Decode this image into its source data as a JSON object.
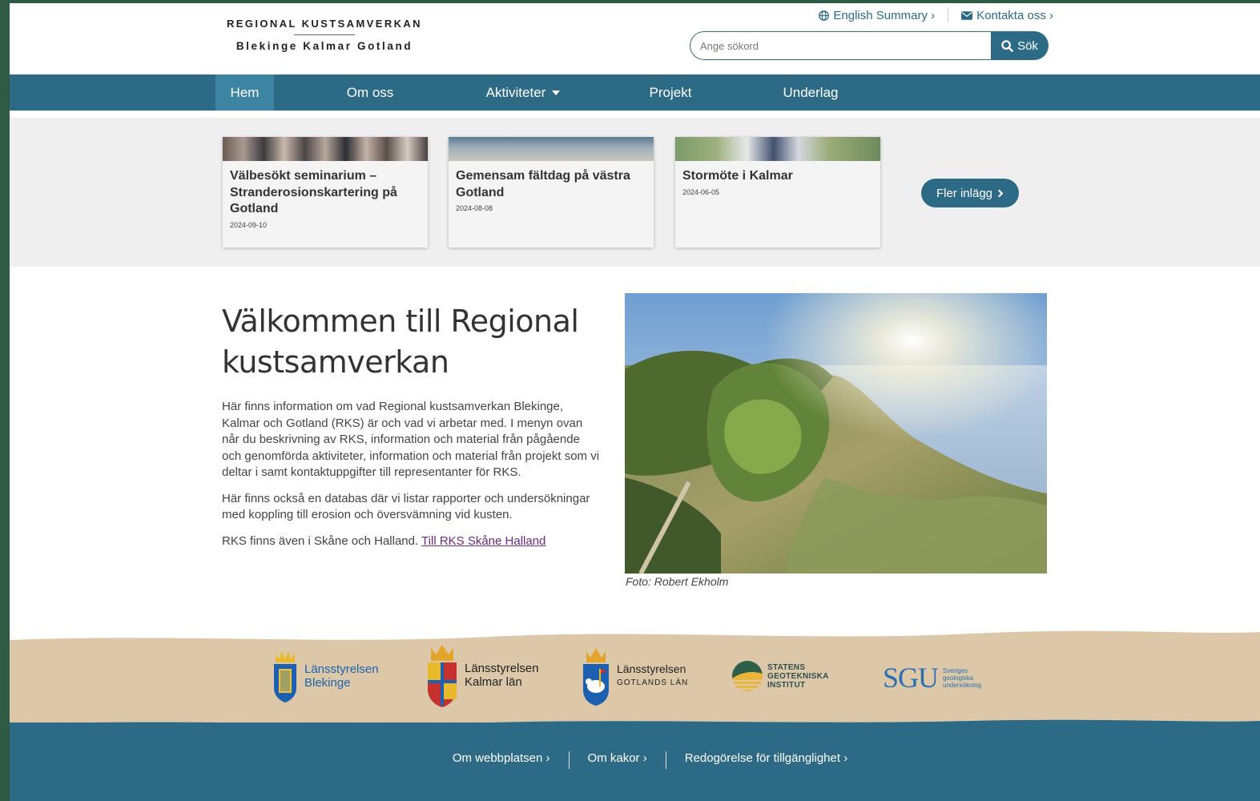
{
  "logo": {
    "top": "REGIONAL KUSTSAMVERKAN",
    "bottom": "Blekinge Kalmar Gotland"
  },
  "utility": {
    "english": "English Summary ›",
    "contact": "Kontakta oss ›"
  },
  "search": {
    "placeholder": "Ange sökord",
    "button": "Sök"
  },
  "nav": [
    {
      "label": "Hem"
    },
    {
      "label": "Om oss"
    },
    {
      "label": "Aktiviteter"
    },
    {
      "label": "Projekt"
    },
    {
      "label": "Underlag"
    }
  ],
  "news": {
    "cards": [
      {
        "title": "Välbesökt seminarium – Stranderosionskartering på Gotland",
        "date": "2024-09-10"
      },
      {
        "title": "Gemensam fältdag på västra Gotland",
        "date": "2024-08-08"
      },
      {
        "title": "Stormöte i Kalmar",
        "date": "2024-06-05"
      }
    ],
    "more": "Fler inlägg"
  },
  "intro": {
    "heading": "Välkommen till  Regional kustsamverkan",
    "p1": "Här finns information om vad Regional kustsamverkan Blekinge, Kalmar och Gotland (RKS) är och vad vi arbetar med. I menyn ovan når du beskrivning av RKS, information och material från pågående och genomförda aktiviteter, information och material från projekt som vi deltar i samt kontaktuppgifter till representanter för RKS.",
    "p2": "Här finns också en databas där vi listar rapporter och undersökningar med koppling till erosion och översvämning vid kusten.",
    "p3_text": "RKS finns även i Skåne och Halland. ",
    "p3_link": "Till RKS Skåne Halland"
  },
  "photo_caption": "Foto: Robert Ekholm",
  "partners": {
    "blekinge": [
      "Länsstyrelsen",
      "Blekinge"
    ],
    "kalmar": [
      "Länsstyrelsen",
      "Kalmar län"
    ],
    "gotland": [
      "Länsstyrelsen",
      "GOTLANDS LÄN"
    ],
    "sgi": [
      "STATENS",
      "GEOTEKNISKA",
      "INSTITUT"
    ],
    "sgu": {
      "mark": "SGU",
      "lines": [
        "Sveriges",
        "geologiska",
        "undersökning"
      ]
    }
  },
  "footer": {
    "links": [
      "Om webbplatsen ›",
      "Om kakor ›",
      "Redogörelse för tillgänglighet ›"
    ]
  },
  "colors": {
    "brand": "#2c6a85",
    "nav_active": "#3d84a3",
    "sand": "#dcc8a8",
    "link_visited": "#6a2a7f"
  }
}
